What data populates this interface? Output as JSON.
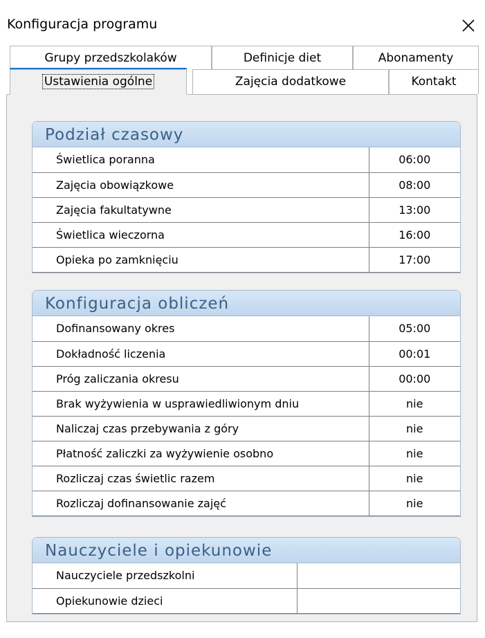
{
  "window": {
    "title": "Konfiguracja programu",
    "close_icon": "close-icon"
  },
  "tabs": {
    "back_row": [
      {
        "label": "Grupy przedszkolaków"
      },
      {
        "label": "Definicje diet"
      },
      {
        "label": "Abonamenty"
      }
    ],
    "front_row": [
      {
        "label": "Ustawienia ogólne",
        "active": true
      },
      {
        "label": "Zajęcia dodatkowe"
      },
      {
        "label": "Kontakt"
      }
    ]
  },
  "sections": {
    "podzial": {
      "title": "Podział czasowy",
      "rows": [
        {
          "label": "Świetlica poranna",
          "value": "06:00"
        },
        {
          "label": "Zajęcia obowiązkowe",
          "value": "08:00"
        },
        {
          "label": "Zajęcia fakultatywne",
          "value": "13:00"
        },
        {
          "label": "Świetlica wieczorna",
          "value": "16:00"
        },
        {
          "label": "Opieka po zamknięciu",
          "value": "17:00"
        }
      ]
    },
    "obliczenia": {
      "title": "Konfiguracja obliczeń",
      "rows": [
        {
          "label": "Dofinansowany okres",
          "value": "05:00"
        },
        {
          "label": "Dokładność liczenia",
          "value": "00:01"
        },
        {
          "label": "Próg zaliczania okresu",
          "value": "00:00"
        },
        {
          "label": "Brak wyżywienia w usprawiedliwionym dniu",
          "value": "nie"
        },
        {
          "label": "Naliczaj czas przebywania z góry",
          "value": "nie"
        },
        {
          "label": "Płatność zaliczki za wyżywienie osobno",
          "value": "nie"
        },
        {
          "label": "Rozliczaj czas świetlic razem",
          "value": "nie"
        },
        {
          "label": "Rozliczaj dofinansowanie zajęć",
          "value": "nie"
        }
      ]
    },
    "nauczyciele": {
      "title": "Nauczyciele i opiekunowie",
      "rows": [
        {
          "label": "Nauczyciele przedszkolni",
          "value": ""
        },
        {
          "label": "Opiekunowie dzieci",
          "value": ""
        }
      ]
    }
  },
  "colors": {
    "section_header_text": "#3d5f86",
    "section_header_bg": "#c7dcf1",
    "tab_underline": "#1a73c9",
    "panel_bg": "#f0f0f0"
  }
}
